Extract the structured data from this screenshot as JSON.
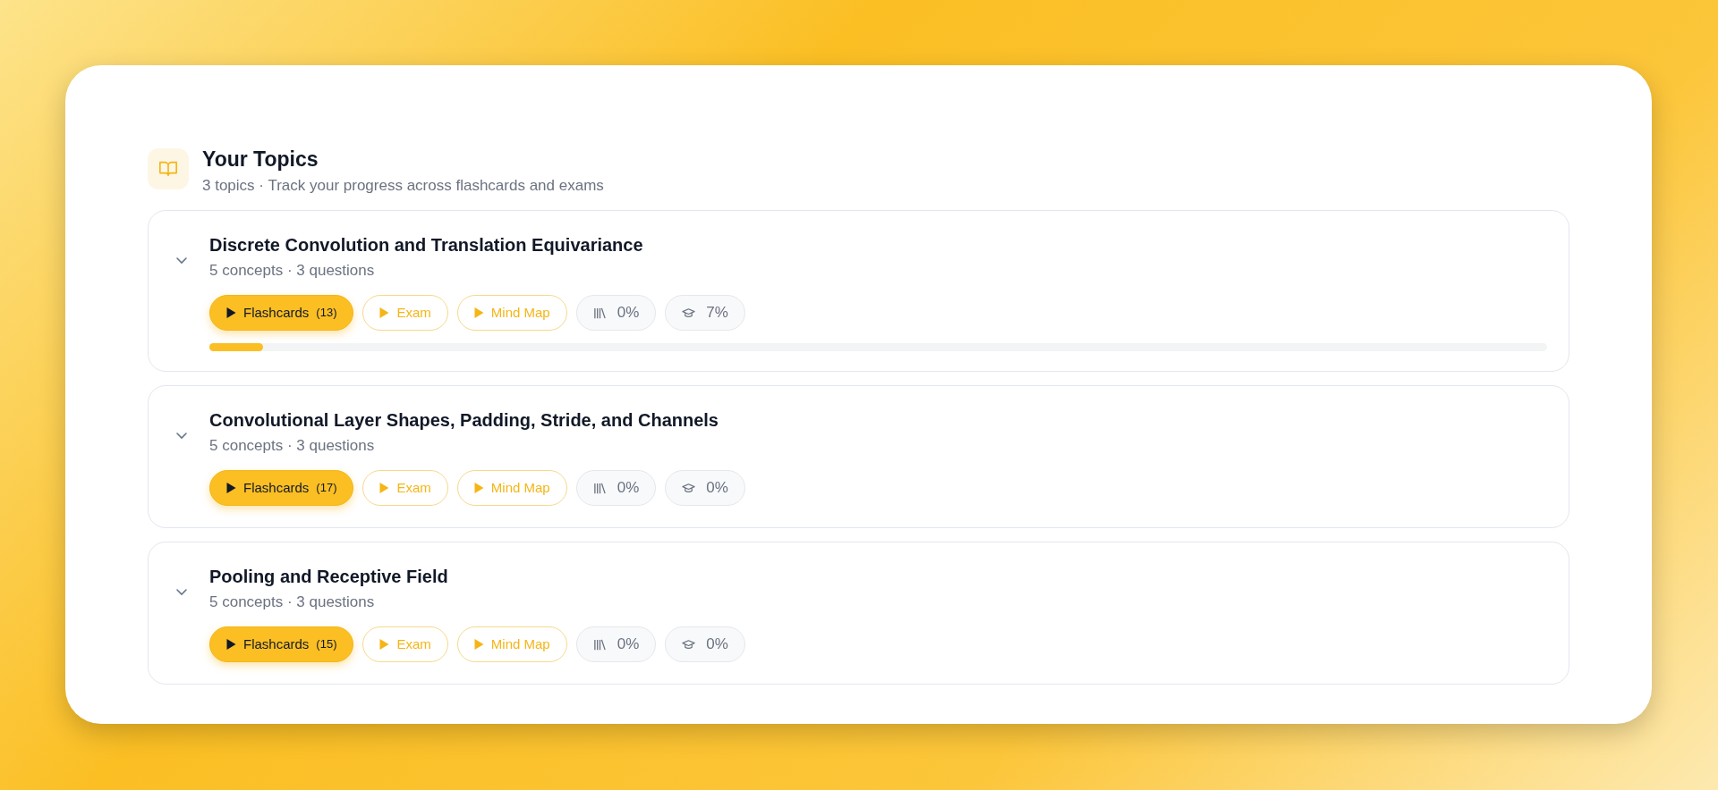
{
  "header": {
    "title": "Your Topics",
    "subtitle": "3 topics · Track your progress across flashcards and exams"
  },
  "topics": [
    {
      "title": "Discrete Convolution and Translation Equivariance",
      "meta": "5 concepts · 3 questions",
      "expanded": false,
      "flashcards": {
        "label": "Flashcards",
        "count": "(13)"
      },
      "exam": "Exam",
      "mind_map": "Mind Map",
      "flashcard_progress": "0%",
      "exam_progress": "7%",
      "progress": {
        "level": 0.04
      }
    },
    {
      "title": "Convolutional Layer Shapes, Padding, Stride, and Channels",
      "meta": "5 concepts · 3 questions",
      "expanded": false,
      "flashcards": {
        "label": "Flashcards",
        "count": "(17)"
      },
      "exam": "Exam",
      "mind_map": "Mind Map",
      "flashcard_progress": "0%",
      "exam_progress": "0%"
    },
    {
      "title": "Pooling and Receptive Field",
      "meta": "5 concepts · 3 questions",
      "expanded": false,
      "flashcards": {
        "label": "Flashcards",
        "count": "(15)"
      },
      "exam": "Exam",
      "mind_map": "Mind Map",
      "flashcard_progress": "0%",
      "exam_progress": "0%"
    }
  ]
}
